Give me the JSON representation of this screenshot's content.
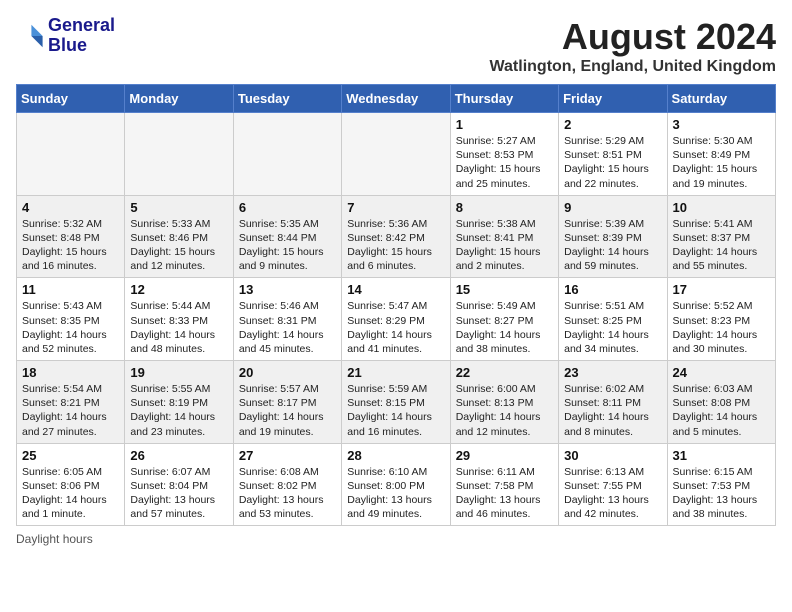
{
  "header": {
    "logo_line1": "General",
    "logo_line2": "Blue",
    "month_year": "August 2024",
    "location": "Watlington, England, United Kingdom"
  },
  "footer": {
    "note": "Daylight hours"
  },
  "days_of_week": [
    "Sunday",
    "Monday",
    "Tuesday",
    "Wednesday",
    "Thursday",
    "Friday",
    "Saturday"
  ],
  "weeks": [
    [
      {
        "day": "",
        "info": ""
      },
      {
        "day": "",
        "info": ""
      },
      {
        "day": "",
        "info": ""
      },
      {
        "day": "",
        "info": ""
      },
      {
        "day": "1",
        "info": "Sunrise: 5:27 AM\nSunset: 8:53 PM\nDaylight: 15 hours\nand 25 minutes."
      },
      {
        "day": "2",
        "info": "Sunrise: 5:29 AM\nSunset: 8:51 PM\nDaylight: 15 hours\nand 22 minutes."
      },
      {
        "day": "3",
        "info": "Sunrise: 5:30 AM\nSunset: 8:49 PM\nDaylight: 15 hours\nand 19 minutes."
      }
    ],
    [
      {
        "day": "4",
        "info": "Sunrise: 5:32 AM\nSunset: 8:48 PM\nDaylight: 15 hours\nand 16 minutes."
      },
      {
        "day": "5",
        "info": "Sunrise: 5:33 AM\nSunset: 8:46 PM\nDaylight: 15 hours\nand 12 minutes."
      },
      {
        "day": "6",
        "info": "Sunrise: 5:35 AM\nSunset: 8:44 PM\nDaylight: 15 hours\nand 9 minutes."
      },
      {
        "day": "7",
        "info": "Sunrise: 5:36 AM\nSunset: 8:42 PM\nDaylight: 15 hours\nand 6 minutes."
      },
      {
        "day": "8",
        "info": "Sunrise: 5:38 AM\nSunset: 8:41 PM\nDaylight: 15 hours\nand 2 minutes."
      },
      {
        "day": "9",
        "info": "Sunrise: 5:39 AM\nSunset: 8:39 PM\nDaylight: 14 hours\nand 59 minutes."
      },
      {
        "day": "10",
        "info": "Sunrise: 5:41 AM\nSunset: 8:37 PM\nDaylight: 14 hours\nand 55 minutes."
      }
    ],
    [
      {
        "day": "11",
        "info": "Sunrise: 5:43 AM\nSunset: 8:35 PM\nDaylight: 14 hours\nand 52 minutes."
      },
      {
        "day": "12",
        "info": "Sunrise: 5:44 AM\nSunset: 8:33 PM\nDaylight: 14 hours\nand 48 minutes."
      },
      {
        "day": "13",
        "info": "Sunrise: 5:46 AM\nSunset: 8:31 PM\nDaylight: 14 hours\nand 45 minutes."
      },
      {
        "day": "14",
        "info": "Sunrise: 5:47 AM\nSunset: 8:29 PM\nDaylight: 14 hours\nand 41 minutes."
      },
      {
        "day": "15",
        "info": "Sunrise: 5:49 AM\nSunset: 8:27 PM\nDaylight: 14 hours\nand 38 minutes."
      },
      {
        "day": "16",
        "info": "Sunrise: 5:51 AM\nSunset: 8:25 PM\nDaylight: 14 hours\nand 34 minutes."
      },
      {
        "day": "17",
        "info": "Sunrise: 5:52 AM\nSunset: 8:23 PM\nDaylight: 14 hours\nand 30 minutes."
      }
    ],
    [
      {
        "day": "18",
        "info": "Sunrise: 5:54 AM\nSunset: 8:21 PM\nDaylight: 14 hours\nand 27 minutes."
      },
      {
        "day": "19",
        "info": "Sunrise: 5:55 AM\nSunset: 8:19 PM\nDaylight: 14 hours\nand 23 minutes."
      },
      {
        "day": "20",
        "info": "Sunrise: 5:57 AM\nSunset: 8:17 PM\nDaylight: 14 hours\nand 19 minutes."
      },
      {
        "day": "21",
        "info": "Sunrise: 5:59 AM\nSunset: 8:15 PM\nDaylight: 14 hours\nand 16 minutes."
      },
      {
        "day": "22",
        "info": "Sunrise: 6:00 AM\nSunset: 8:13 PM\nDaylight: 14 hours\nand 12 minutes."
      },
      {
        "day": "23",
        "info": "Sunrise: 6:02 AM\nSunset: 8:11 PM\nDaylight: 14 hours\nand 8 minutes."
      },
      {
        "day": "24",
        "info": "Sunrise: 6:03 AM\nSunset: 8:08 PM\nDaylight: 14 hours\nand 5 minutes."
      }
    ],
    [
      {
        "day": "25",
        "info": "Sunrise: 6:05 AM\nSunset: 8:06 PM\nDaylight: 14 hours\nand 1 minute."
      },
      {
        "day": "26",
        "info": "Sunrise: 6:07 AM\nSunset: 8:04 PM\nDaylight: 13 hours\nand 57 minutes."
      },
      {
        "day": "27",
        "info": "Sunrise: 6:08 AM\nSunset: 8:02 PM\nDaylight: 13 hours\nand 53 minutes."
      },
      {
        "day": "28",
        "info": "Sunrise: 6:10 AM\nSunset: 8:00 PM\nDaylight: 13 hours\nand 49 minutes."
      },
      {
        "day": "29",
        "info": "Sunrise: 6:11 AM\nSunset: 7:58 PM\nDaylight: 13 hours\nand 46 minutes."
      },
      {
        "day": "30",
        "info": "Sunrise: 6:13 AM\nSunset: 7:55 PM\nDaylight: 13 hours\nand 42 minutes."
      },
      {
        "day": "31",
        "info": "Sunrise: 6:15 AM\nSunset: 7:53 PM\nDaylight: 13 hours\nand 38 minutes."
      }
    ]
  ]
}
